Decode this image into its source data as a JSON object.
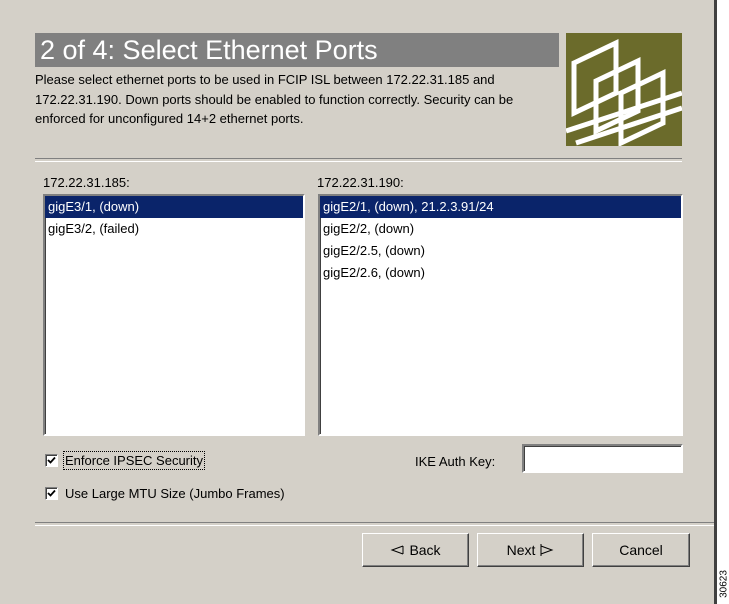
{
  "wizard": {
    "title": "2 of 4: Select Ethernet Ports",
    "description": "Please select ethernet ports to be used in FCIP ISL between 172.22.31.185 and 172.22.31.190.  Down ports should be enabled to function correctly. Security can be enforced for unconfigured 14+2 ethernet ports."
  },
  "left_switch": {
    "label": "172.22.31.185:",
    "ports": [
      {
        "text": "gigE3/1, (down)",
        "selected": true
      },
      {
        "text": "gigE3/2, (failed)",
        "selected": false
      }
    ]
  },
  "right_switch": {
    "label": "172.22.31.190:",
    "ports": [
      {
        "text": "gigE2/1, (down), 21.2.3.91/24",
        "selected": true
      },
      {
        "text": "gigE2/2, (down)",
        "selected": false
      },
      {
        "text": "gigE2/2.5, (down)",
        "selected": false
      },
      {
        "text": "gigE2/2.6, (down)",
        "selected": false
      }
    ]
  },
  "options": {
    "ipsec_label": "Enforce IPSEC Security",
    "ipsec_checked": true,
    "jumbo_label": "Use Large MTU Size (Jumbo Frames)",
    "jumbo_checked": true,
    "ike_label": "IKE Auth Key:",
    "ike_value": ""
  },
  "buttons": {
    "back": "Back",
    "next": "Next",
    "cancel": "Cancel"
  },
  "figure_id": "30623",
  "icons": {
    "back": "back-arrow-icon",
    "next": "next-arrow-icon",
    "checkmark": "checkmark-icon",
    "logo": "network-module-logo"
  },
  "colors": {
    "panel": "#d4d0c8",
    "title_bar": "#808080",
    "selection": "#0a246a",
    "logo": "#6b6b2b"
  }
}
